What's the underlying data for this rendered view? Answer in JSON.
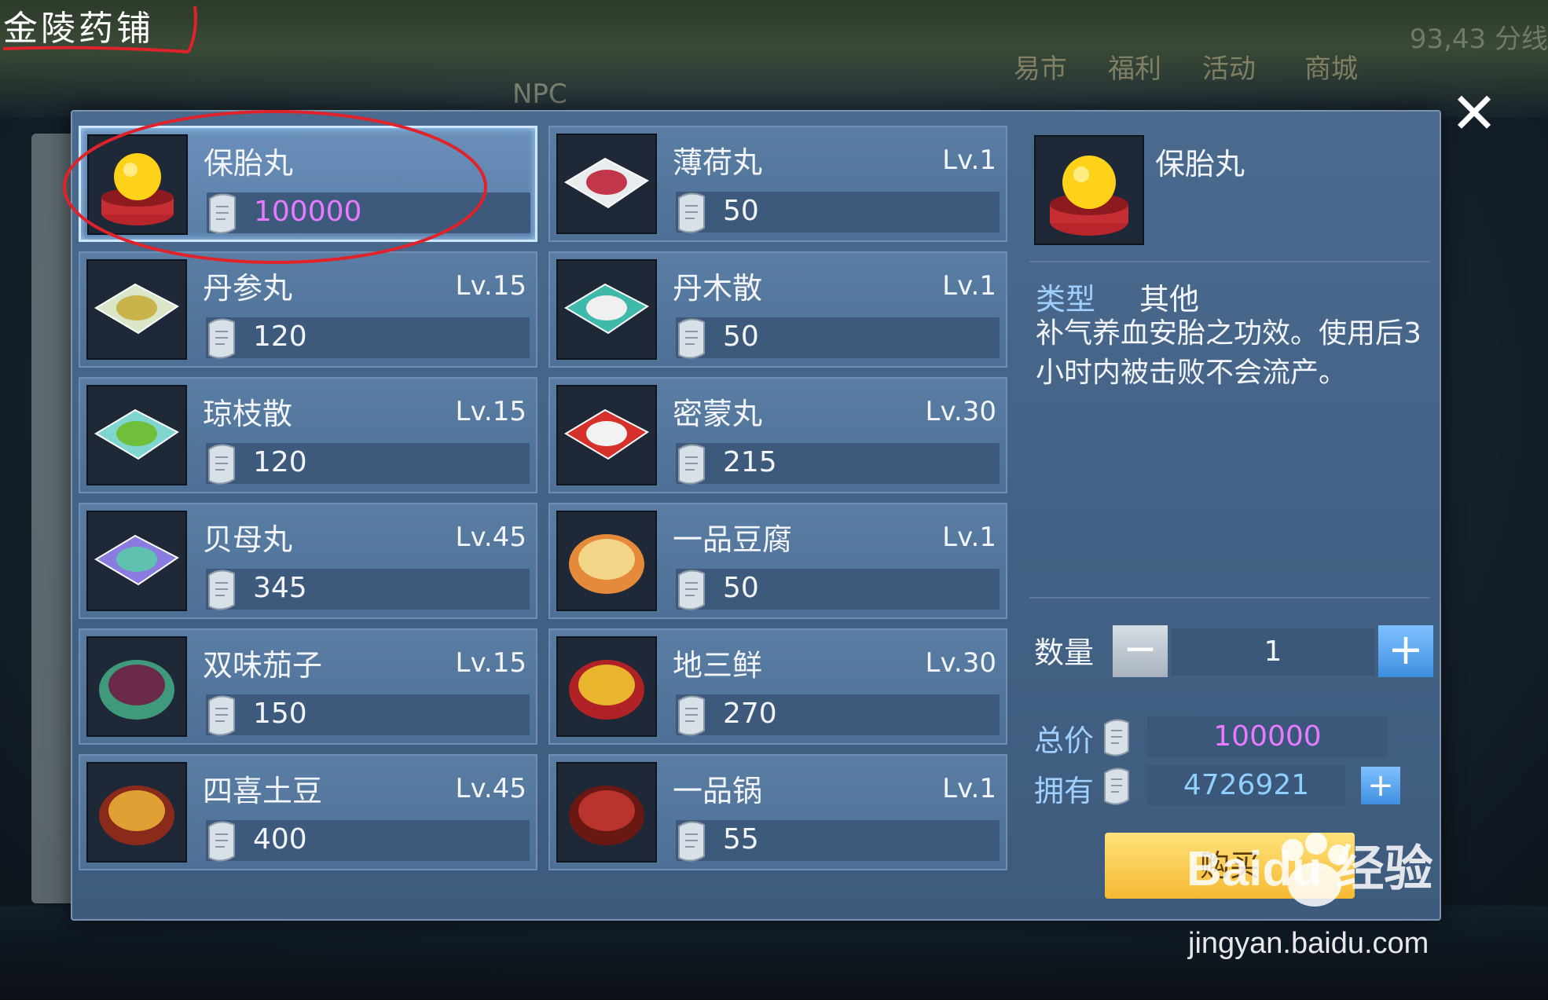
{
  "shop_title": "金陵药铺",
  "background": {
    "top_menu": [
      "易市",
      "福利",
      "活动",
      "商城"
    ],
    "npc_label": "NPC",
    "coords": "93,43 分线"
  },
  "items": [
    {
      "name": "保胎丸",
      "level": "",
      "price": "100000",
      "icon": "golden-pill-icon",
      "selected": true
    },
    {
      "name": "薄荷丸",
      "level": "Lv.1",
      "price": "50",
      "icon": "red-powder-packet-icon"
    },
    {
      "name": "丹参丸",
      "level": "Lv.15",
      "price": "120",
      "icon": "yellow-powder-packet-icon"
    },
    {
      "name": "丹木散",
      "level": "Lv.1",
      "price": "50",
      "icon": "white-powder-teal-packet-icon"
    },
    {
      "name": "琼枝散",
      "level": "Lv.15",
      "price": "120",
      "icon": "green-powder-packet-icon"
    },
    {
      "name": "密蒙丸",
      "level": "Lv.30",
      "price": "215",
      "icon": "white-powder-red-packet-icon"
    },
    {
      "name": "贝母丸",
      "level": "Lv.45",
      "price": "345",
      "icon": "teal-powder-purple-packet-icon"
    },
    {
      "name": "一品豆腐",
      "level": "Lv.1",
      "price": "50",
      "icon": "tofu-dish-icon"
    },
    {
      "name": "双味茄子",
      "level": "Lv.15",
      "price": "150",
      "icon": "eggplant-dish-icon"
    },
    {
      "name": "地三鲜",
      "level": "Lv.30",
      "price": "270",
      "icon": "vegetable-dish-icon"
    },
    {
      "name": "四喜土豆",
      "level": "Lv.45",
      "price": "400",
      "icon": "potato-bowl-icon"
    },
    {
      "name": "一品锅",
      "level": "Lv.1",
      "price": "55",
      "icon": "hotpot-icon"
    }
  ],
  "detail": {
    "name": "保胎丸",
    "type_label": "类型",
    "type_value": "其他",
    "description": "补气养血安胎之功效。使用后3小时内被击败不会流产。",
    "quantity_label": "数量",
    "quantity": "1",
    "minus_label": "−",
    "plus_label": "+",
    "total_label": "总价",
    "total_value": "100000",
    "own_label": "拥有",
    "own_value": "4726921",
    "buy_label": "购买"
  },
  "close_label": "✕",
  "watermark": {
    "main": "Baidu 经验",
    "sub": "jingyan.baidu.com"
  },
  "colors": {
    "price_highlight": "#e67bff",
    "own_value": "#8fd0ff",
    "buy_button": "#f5b933",
    "panel": "#4a6a8e"
  }
}
